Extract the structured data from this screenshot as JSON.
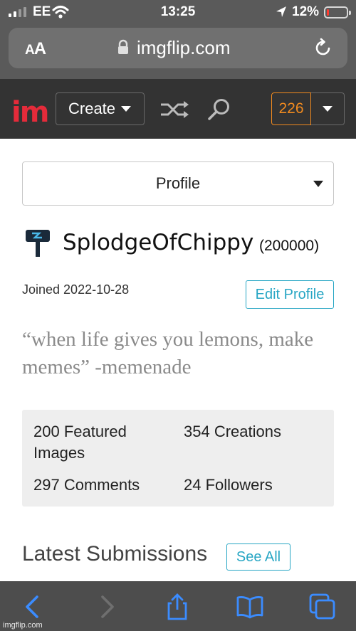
{
  "status_bar": {
    "carrier": "EE",
    "time": "13:25",
    "battery_percent": "12%",
    "battery_level": 0.12,
    "signal_bars": 2,
    "battery_color": "#ff3b30"
  },
  "browser": {
    "text_size_label": "AA",
    "domain": "imgflip.com"
  },
  "header": {
    "logo": "im",
    "create_label": "Create",
    "notification_count": "226",
    "accent_color": "#f08a1f"
  },
  "profile_select": {
    "label": "Profile"
  },
  "user": {
    "username": "SplodgeOfChippy",
    "points": "(200000)",
    "joined": "Joined 2022-10-28",
    "edit_label": "Edit Profile",
    "bio": "“when life gives you lemons, make memes” -memenade"
  },
  "stats": [
    {
      "label": "200 Featured Images"
    },
    {
      "label": "354 Creations"
    },
    {
      "label": "297 Comments"
    },
    {
      "label": "24 Followers"
    }
  ],
  "latest": {
    "heading": "Latest Submissions",
    "see_all_label": "See All"
  },
  "toolbar": {
    "icons": [
      "back-icon",
      "forward-icon",
      "share-icon",
      "bookmarks-icon",
      "tabs-icon"
    ],
    "icon_color": "#3b8cff"
  },
  "watermark": "imgflip.com"
}
